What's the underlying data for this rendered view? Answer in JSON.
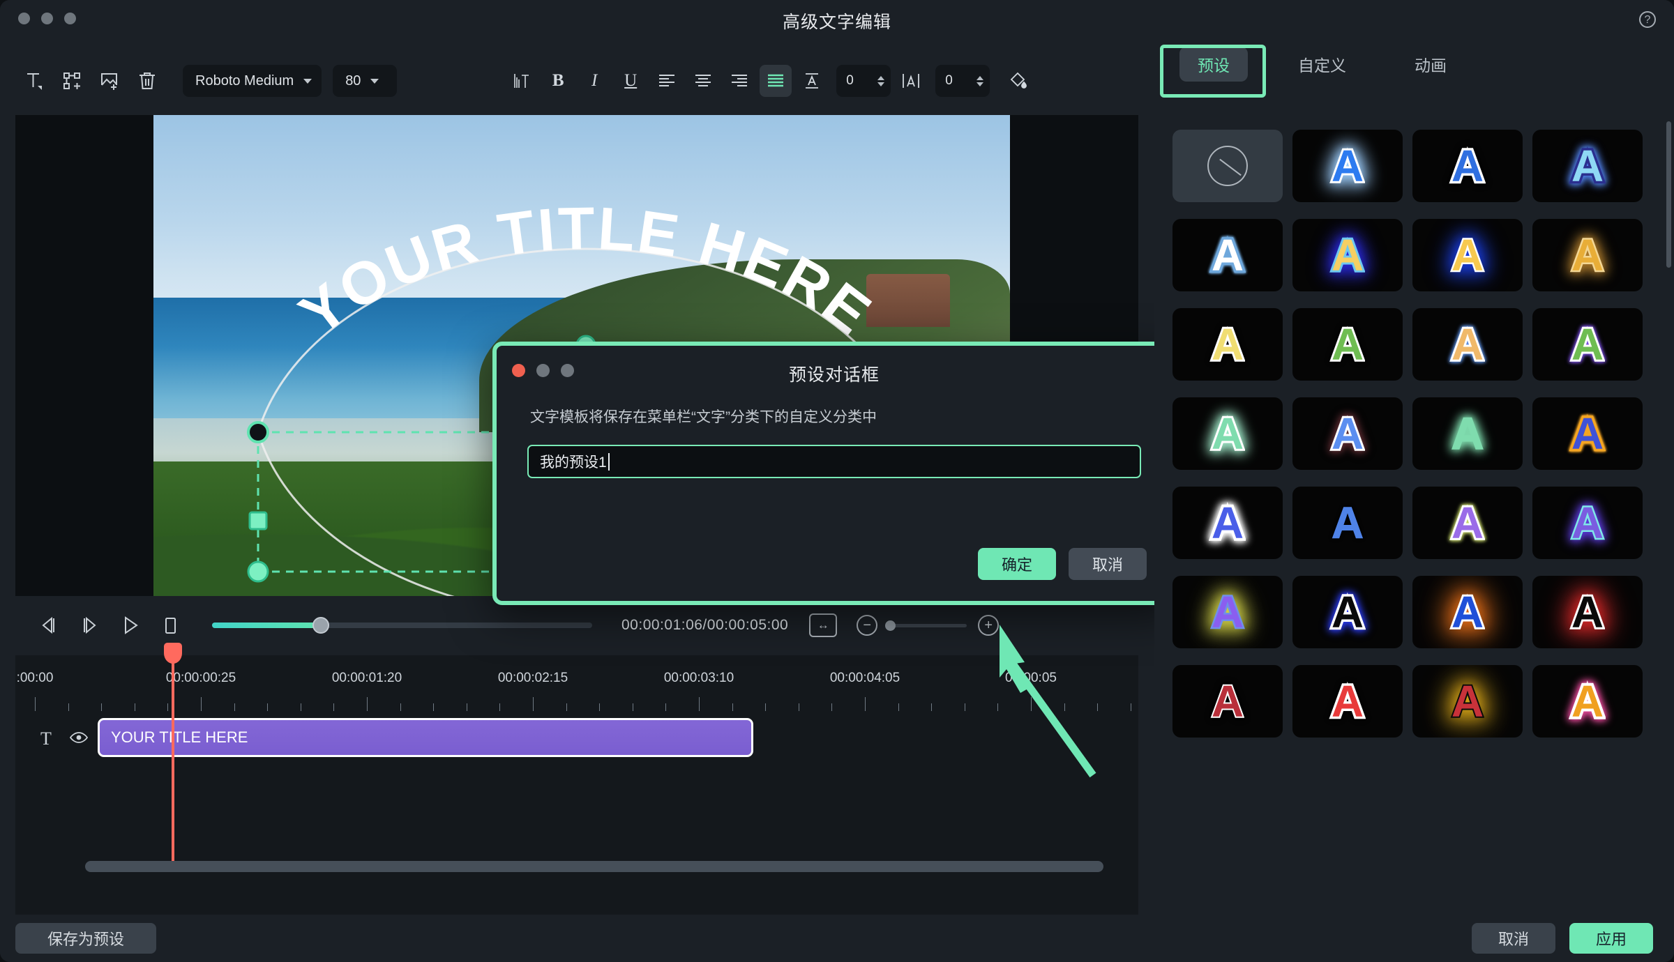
{
  "window": {
    "title": "高级文字编辑",
    "help_icon": "question-mark-icon"
  },
  "toolbar": {
    "icons": [
      {
        "name": "text-tool-icon",
        "label": "T"
      },
      {
        "name": "transform-add-icon",
        "label": ""
      },
      {
        "name": "image-add-icon",
        "label": ""
      },
      {
        "name": "delete-icon",
        "label": ""
      }
    ],
    "font_family": "Roboto Medium",
    "font_size": "80",
    "format_buttons": [
      {
        "name": "vertical-text-icon",
        "label": "ITI"
      },
      {
        "name": "bold-button",
        "label": "B"
      },
      {
        "name": "italic-button",
        "label": "I"
      },
      {
        "name": "underline-button",
        "label": "U"
      },
      {
        "name": "align-left-button",
        "label": ""
      },
      {
        "name": "align-center-button",
        "label": ""
      },
      {
        "name": "align-right-button",
        "label": ""
      },
      {
        "name": "align-justify-button",
        "label": ""
      }
    ],
    "line_spacing_value": "0",
    "letter_spacing_value": "0",
    "fill-color-icon": "bucket-icon"
  },
  "preview": {
    "text": "YOUR TITLE HERE"
  },
  "transport": {
    "buttons": [
      {
        "name": "prev-frame-button"
      },
      {
        "name": "next-frame-button"
      },
      {
        "name": "play-button"
      },
      {
        "name": "stop-button"
      }
    ],
    "timecode": "00:00:01:06/00:00:05:00",
    "fit-icon": "fit-to-screen-icon",
    "zoom_out": "−",
    "zoom_in": "+"
  },
  "timeline": {
    "ruler_labels": [
      ":00:00",
      "00:00:00:25",
      "00:00:01:20",
      "00:00:02:15",
      "00:00:03:10",
      "00:00:04:05",
      "00:00:05"
    ],
    "track_icons": [
      {
        "name": "text-track-icon",
        "glyph": "T"
      },
      {
        "name": "visibility-eye-icon",
        "glyph": "◉"
      }
    ],
    "clip_label": "YOUR TITLE HERE"
  },
  "dialog": {
    "title": "预设对话框",
    "description": "文字模板将保存在菜单栏“文字”分类下的自定义分类中",
    "input_value": "我的预设1",
    "ok_label": "确定",
    "cancel_label": "取消"
  },
  "right_panel": {
    "tabs": [
      {
        "label": "预设",
        "selected": true
      },
      {
        "label": "自定义",
        "selected": false
      },
      {
        "label": "动画",
        "selected": false
      }
    ],
    "presets": [
      {
        "kind": "none",
        "name": "no-style-preset"
      },
      {
        "kind": "letter",
        "fill": "#2d7bf0",
        "stroke": "#ffffff",
        "glow": "#9fd0ff",
        "strokeW": 6,
        "blur": 14
      },
      {
        "kind": "letter",
        "fill": "#2f6fe0",
        "stroke": "#ffffff",
        "glow": "#000000",
        "strokeW": 7,
        "blur": 4
      },
      {
        "kind": "letter",
        "fill": "#8fd8f5",
        "stroke": "#2b2f8f",
        "glow": "#4f7fe8",
        "strokeW": 7,
        "blur": 6
      },
      {
        "kind": "letter",
        "fill": "#ffffff",
        "stroke": "#6fa8dc",
        "glow": "#6fa8dc",
        "strokeW": 7,
        "blur": 2
      },
      {
        "kind": "letter",
        "fill": "#f6cf63",
        "stroke": "#6ec8f0",
        "glow": "#2a2ae0",
        "strokeW": 6,
        "blur": 14
      },
      {
        "kind": "letter",
        "fill": "#f7c94f",
        "stroke": "#ffffff",
        "glow": "#1b3fe8",
        "strokeW": 5,
        "blur": 16
      },
      {
        "kind": "letter",
        "fill": "#e8ad37",
        "stroke": "#f3d694",
        "glow": "#a8772a",
        "strokeW": 5,
        "blur": 10
      },
      {
        "kind": "letter",
        "fill": "#f0dd72",
        "stroke": "#ffffff",
        "glow": "#000000",
        "strokeW": 6,
        "blur": 3
      },
      {
        "kind": "letter",
        "fill": "#6fbd52",
        "stroke": "#ffffff",
        "glow": "#000000",
        "strokeW": 6,
        "blur": 3
      },
      {
        "kind": "letter",
        "fill": "#f0b96a",
        "stroke": "#ffffff",
        "glow": "#5c8fe0",
        "strokeW": 6,
        "blur": 3
      },
      {
        "kind": "letter",
        "fill": "#6fbd52",
        "stroke": "#ffffff",
        "glow": "#7a4fe0",
        "strokeW": 6,
        "blur": 3
      },
      {
        "kind": "letter",
        "fill": "#7fdcae",
        "stroke": "#ffffff",
        "glow": "#9fe8c8",
        "strokeW": 6,
        "blur": 10
      },
      {
        "kind": "letter",
        "fill": "#5b8ef0",
        "stroke": "#ffffff",
        "glow": "#5a2a30",
        "strokeW": 6,
        "blur": 6
      },
      {
        "kind": "letter",
        "fill": "#7fdcae",
        "stroke": "#7fdcae",
        "glow": "#7fdcae",
        "strokeW": 2,
        "blur": 8
      },
      {
        "kind": "letter",
        "fill": "#3f52d8",
        "stroke": "#f5a623",
        "glow": "#f5a623",
        "strokeW": 7,
        "blur": 2
      },
      {
        "kind": "letter",
        "fill": "#4a5ee8",
        "stroke": "#ffffff",
        "glow": "#ffffff",
        "strokeW": 8,
        "blur": 6
      },
      {
        "kind": "letter",
        "fill": "#4f83e8",
        "stroke": "#4f83e8",
        "glow": "#000000",
        "strokeW": 1,
        "blur": 2
      },
      {
        "kind": "letter",
        "fill": "#9a6ce8",
        "stroke": "#ffffff",
        "glow": "#c8d86a",
        "strokeW": 6,
        "blur": 3
      },
      {
        "kind": "letter",
        "fill": "#7a5ce0",
        "stroke": "#7fe8e8",
        "glow": "#5a3ad8",
        "strokeW": 5,
        "blur": 8
      },
      {
        "kind": "letter",
        "fill": "#8a5ef0",
        "stroke": "#6f8fe8",
        "glow": "#d8d84a",
        "strokeW": 5,
        "blur": 16
      },
      {
        "kind": "letter",
        "fill": "#0a0a0a",
        "stroke": "#ffffff",
        "glow": "#2a3ae8",
        "strokeW": 7,
        "blur": 6
      },
      {
        "kind": "letter",
        "fill": "#1f4fd8",
        "stroke": "#ffffff",
        "glow": "#ff7a1a",
        "strokeW": 6,
        "blur": 22
      },
      {
        "kind": "letter",
        "fill": "#0a0a0a",
        "stroke": "#ffffff",
        "glow": "#e82a2a",
        "strokeW": 6,
        "blur": 20
      },
      {
        "kind": "letter",
        "fill": "#b92f3a",
        "stroke": "#ffffff",
        "glow": "#000000",
        "strokeW": 4,
        "blur": 4
      },
      {
        "kind": "letter",
        "fill": "#e83a3a",
        "stroke": "#ffffff",
        "glow": "#000000",
        "strokeW": 7,
        "blur": 3
      },
      {
        "kind": "letter",
        "fill": "#c8323a",
        "stroke": "#0a0a0a",
        "glow": "#f0b81a",
        "strokeW": 4,
        "blur": 20
      },
      {
        "kind": "letter",
        "fill": "#f0a020",
        "stroke": "#ffffff",
        "glow": "#e84a9a",
        "strokeW": 8,
        "blur": 6
      }
    ]
  },
  "footer": {
    "save_preset_label": "保存为预设",
    "cancel_label": "取消",
    "apply_label": "应用"
  },
  "colors": {
    "accent": "#6fe7b4",
    "panel_bg": "#1b2026",
    "clip": "#7a5ed0",
    "playhead": "#ff6a5e"
  }
}
